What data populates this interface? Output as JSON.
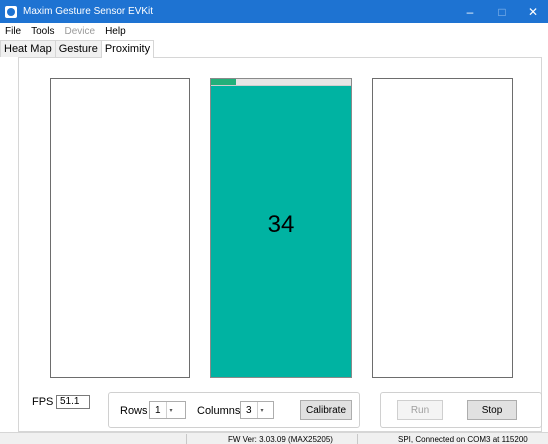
{
  "window": {
    "title": "Maxim Gesture Sensor EVKit",
    "accent": "#1e73d2",
    "controls": {
      "minimize": "–",
      "maximize": "□",
      "close": "✕"
    }
  },
  "menu": {
    "items": [
      {
        "label": "File",
        "enabled": true
      },
      {
        "label": "Tools",
        "enabled": true
      },
      {
        "label": "Device",
        "enabled": false
      },
      {
        "label": "Help",
        "enabled": true
      }
    ]
  },
  "tabs": [
    {
      "label": "Heat Map",
      "active": false
    },
    {
      "label": "Gesture",
      "active": false
    },
    {
      "label": "Proximity",
      "active": true
    }
  ],
  "proximity": {
    "center_value": "34",
    "center_color": "#00b3a2",
    "center_progress_fraction": 0.18
  },
  "fps": {
    "label": "FPS",
    "value": "51.1"
  },
  "config": {
    "rows_label": "Rows",
    "rows_value": "1",
    "columns_label": "Columns",
    "columns_value": "3",
    "spinner_arrow": "▾",
    "calibrate_label": "Calibrate"
  },
  "actions": {
    "run_label": "Run",
    "stop_label": "Stop"
  },
  "status": {
    "firmware": "FW Ver: 3.03.09 (MAX25205)",
    "connection": "SPI, Connected on COM3   at 115200"
  }
}
